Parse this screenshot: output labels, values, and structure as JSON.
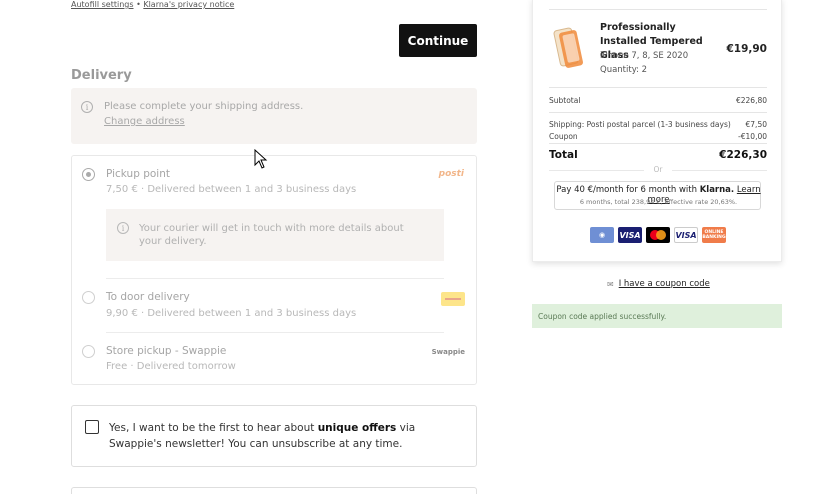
{
  "top_links": {
    "autofill": "Autofill settings",
    "separator": "•",
    "privacy": "Klarna's privacy notice"
  },
  "continue_label": "Continue",
  "delivery": {
    "title": "Delivery",
    "notice": {
      "message": "Please complete your shipping address.",
      "change_link": "Change address"
    },
    "options": [
      {
        "title": "Pickup point",
        "subtitle": "7,50 € · Delivered between 1 and 3 business days",
        "selected": true,
        "carrier": "posti",
        "courier_info": "Your courier will get in touch with more details about your delivery."
      },
      {
        "title": "To door delivery",
        "subtitle": "9,90 € · Delivered between 1 and 3 business days",
        "selected": false,
        "carrier": "dhl"
      },
      {
        "title": "Store pickup - Swappie",
        "subtitle": "Free · Delivered tomorrow",
        "selected": false,
        "carrier": "Swappie"
      }
    ]
  },
  "newsletter": {
    "before": "Yes, I want to be the first to hear about ",
    "bold": "unique offers",
    "after": " via Swappie's newsletter! You can unsubscribe at any time."
  },
  "summary": {
    "product": {
      "title": "Professionally Installed Tempered Glass",
      "variant": "iPhone 7, 8, SE 2020",
      "quantity": "Quantity: 2",
      "price": "€19,90"
    },
    "subtotal_label": "Subtotal",
    "subtotal_value": "€226,80",
    "shipping_label": "Shipping: Posti postal parcel (1-3 business days)",
    "shipping_value": "€7,50",
    "coupon_label": "Coupon",
    "coupon_value": "-€10,00",
    "total_label": "Total",
    "total_value": "€226,30",
    "or_label": "Or",
    "klarna": {
      "line1_pre": "Pay 40 €/month for 6 month with ",
      "brand": "Klarna.",
      "learn_more": "Learn more",
      "line2": "6 months, total 238,94 €, effective rate 20,63%."
    },
    "payment_methods": [
      "MobilePay",
      "VISA",
      "Mastercard",
      "VISA Electron",
      "Online banking"
    ]
  },
  "coupon": {
    "link_label": "I have a coupon code",
    "success": "Coupon code applied successfully."
  },
  "colors": {
    "button_bg": "#111111",
    "success_bg": "#dff0dc",
    "notice_bg": "#f6f3f1"
  }
}
